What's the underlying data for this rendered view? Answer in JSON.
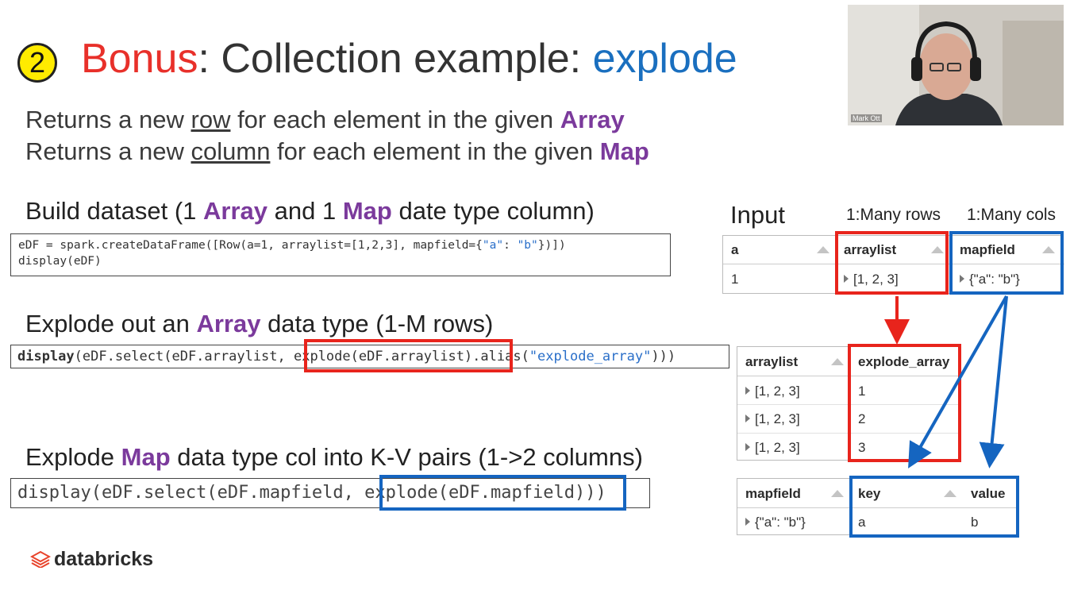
{
  "slide": {
    "badge": "2",
    "title_bonus": "Bonus",
    "title_mid": ": Collection example: ",
    "title_fn": "explode",
    "line1_pre": "Returns a new ",
    "line1_u": "row",
    "line1_mid": " for each element in the given ",
    "line1_b": "Array",
    "line2_pre": "Returns a new ",
    "line2_u": "column",
    "line2_mid": " for each element in the given ",
    "line2_b": "Map",
    "h1_a": "Build dataset (1 ",
    "h1_b": "Array",
    "h1_c": " and 1 ",
    "h1_d": "Map",
    "h1_e": " date type column)",
    "code1_l1a": "eDF = spark.createDataFrame([Row(a=1, arraylist=[1,2,3], mapfield={",
    "code1_l1s1": "\"a\"",
    "code1_l1b": ": ",
    "code1_l1s2": "\"b\"",
    "code1_l1c": "})])",
    "code1_l2": "display(eDF)",
    "h2_a": "Explode out an ",
    "h2_b": "Array",
    "h2_c": " data type (1-M rows)",
    "code2_a": "display",
    "code2_b": "(eDF.select(eDF.arraylist, explode(eDF.arraylist).alias(",
    "code2_s": "\"explode_array\"",
    "code2_c": ")))",
    "h3_a": "Explode ",
    "h3_b": "Map",
    "h3_c": " data type col into K-V pairs (1->2 columns)",
    "code3": "display(eDF.select(eDF.mapfield, explode(eDF.mapfield)))",
    "logo": "databricks"
  },
  "labels": {
    "input": "Input",
    "many_rows": "1:Many rows",
    "many_cols": "1:Many cols"
  },
  "webcam": {
    "name": "Mark Ott"
  },
  "table_input": {
    "headers": [
      "a",
      "arraylist",
      "mapfield"
    ],
    "row": [
      "1",
      "[1, 2, 3]",
      "{\"a\": \"b\"}"
    ]
  },
  "table_array": {
    "headers": [
      "arraylist",
      "explode_array"
    ],
    "rows": [
      [
        "[1, 2, 3]",
        "1"
      ],
      [
        "[1, 2, 3]",
        "2"
      ],
      [
        "[1, 2, 3]",
        "3"
      ]
    ]
  },
  "table_map": {
    "headers": [
      "mapfield",
      "key",
      "value"
    ],
    "row": [
      "{\"a\": \"b\"}",
      "a",
      "b"
    ]
  },
  "colors": {
    "red": "#e8241c",
    "blue": "#1565c0",
    "purple": "#7b3a9c",
    "badge": "#ffeb00"
  }
}
